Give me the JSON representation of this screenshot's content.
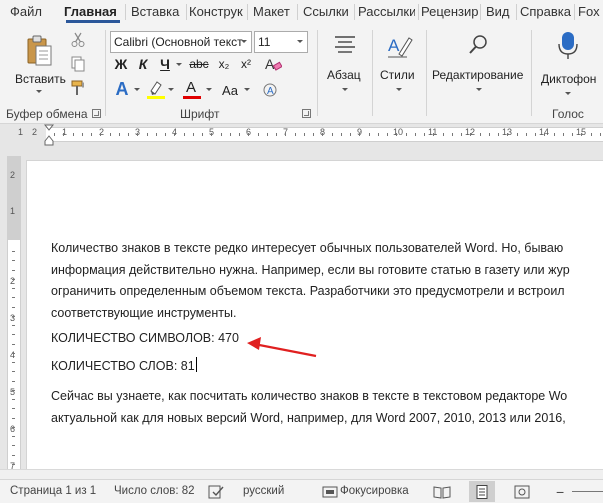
{
  "tabs": [
    {
      "label": "Файл",
      "active": false
    },
    {
      "label": "Главная",
      "active": true
    },
    {
      "label": "Вставка",
      "active": false
    },
    {
      "label": "Конструк",
      "active": false
    },
    {
      "label": "Макет",
      "active": false
    },
    {
      "label": "Ссылки",
      "active": false
    },
    {
      "label": "Рассылки",
      "active": false
    },
    {
      "label": "Рецензир",
      "active": false
    },
    {
      "label": "Вид",
      "active": false
    },
    {
      "label": "Справка",
      "active": false
    },
    {
      "label": "Fox",
      "active": false
    }
  ],
  "ribbon": {
    "clipboard": {
      "paste_label": "Вставить",
      "group_label": "Буфер обмена"
    },
    "font": {
      "font_name": "Calibri (Основной текст",
      "font_size": "11",
      "group_label": "Шрифт",
      "bold": "Ж",
      "italic": "К",
      "underline": "Ч",
      "strikethrough": "abc",
      "subscript": "x₂",
      "superscript": "x²",
      "text_effects": "A",
      "font_color": "A",
      "change_case": "Aa"
    },
    "paragraph": {
      "label": "Абзац"
    },
    "styles": {
      "label": "Стили"
    },
    "editing": {
      "label": "Редактирование"
    },
    "voice": {
      "dictate_label": "Диктофон",
      "group_label": "Голос"
    }
  },
  "ruler": {
    "numbers": [
      "1",
      "2",
      "1",
      "1",
      "2",
      "3",
      "4",
      "5",
      "6",
      "7",
      "8",
      "9",
      "10",
      "11",
      "12",
      "13",
      "14",
      "15"
    ]
  },
  "vruler": {
    "numbers": [
      "2",
      "1",
      "2",
      "3",
      "4",
      "5",
      "6",
      "7",
      "8"
    ]
  },
  "document": {
    "paragraph1": [
      "Количество знаков в тексте редко интересует обычных пользователей Word. Но, бываю",
      "информация действительно нужна. Например, если вы готовите статью в газету или жур",
      "ограничить определенным объемом текста. Разработчики это предусмотрели и встроил",
      "соответствующие инструменты."
    ],
    "char_count": "КОЛИЧЕСТВО СИМВОЛОВ: 470",
    "word_count": "КОЛИЧЕСТВО СЛОВ: 81",
    "paragraph2": [
      "Сейчас вы узнаете, как посчитать количество знаков в тексте в текстовом редакторе Wo",
      "актуальной как для новых версий Word, например, для Word 2007, 2010, 2013 или 2016,"
    ]
  },
  "status": {
    "page": "Страница 1 из 1",
    "words": "Число слов: 82",
    "language": "русский",
    "focus": "Фокусировка"
  },
  "colors": {
    "accent": "#2b579a",
    "arrow": "#e02020",
    "highlight": "#ffff00",
    "font_color": "#e00000"
  }
}
